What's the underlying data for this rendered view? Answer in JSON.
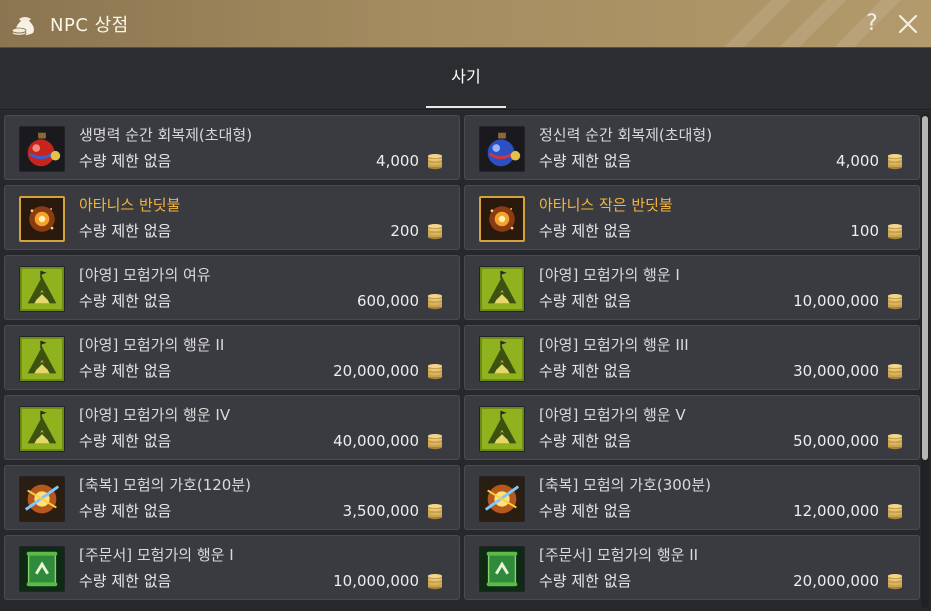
{
  "window": {
    "title": "NPC 상점",
    "help_label": "?"
  },
  "tabs": [
    {
      "label": "사기",
      "active": true
    }
  ],
  "items": [
    {
      "name": "생명력 순간 회복제(초대형)",
      "limit": "수량 제한 없음",
      "price": "4,000",
      "icon": "red-potion-icon",
      "highlight": false
    },
    {
      "name": "정신력 순간 회복제(초대형)",
      "limit": "수량 제한 없음",
      "price": "4,000",
      "icon": "blue-potion-icon",
      "highlight": false
    },
    {
      "name": "아타니스 반딧불",
      "limit": "수량 제한 없음",
      "price": "200",
      "icon": "firefly-icon",
      "highlight": true
    },
    {
      "name": "아타니스 작은 반딧불",
      "limit": "수량 제한 없음",
      "price": "100",
      "icon": "firefly-icon",
      "highlight": true
    },
    {
      "name": "[야영] 모험가의 여유",
      "limit": "수량 제한 없음",
      "price": "600,000",
      "icon": "camp-tent-icon",
      "highlight": false
    },
    {
      "name": "[야영] 모험가의 행운 I",
      "limit": "수량 제한 없음",
      "price": "10,000,000",
      "icon": "camp-tent-icon",
      "highlight": false
    },
    {
      "name": "[야영] 모험가의 행운 II",
      "limit": "수량 제한 없음",
      "price": "20,000,000",
      "icon": "camp-tent-icon",
      "highlight": false
    },
    {
      "name": "[야영] 모험가의 행운 III",
      "limit": "수량 제한 없음",
      "price": "30,000,000",
      "icon": "camp-tent-icon",
      "highlight": false
    },
    {
      "name": "[야영] 모험가의 행운 IV",
      "limit": "수량 제한 없음",
      "price": "40,000,000",
      "icon": "camp-tent-icon",
      "highlight": false
    },
    {
      "name": "[야영] 모험가의 행운 V",
      "limit": "수량 제한 없음",
      "price": "50,000,000",
      "icon": "camp-tent-icon",
      "highlight": false
    },
    {
      "name": "[축복] 모험의 가호(120분)",
      "limit": "수량 제한 없음",
      "price": "3,500,000",
      "icon": "blessing-burst-icon",
      "highlight": false
    },
    {
      "name": "[축복] 모험의 가호(300분)",
      "limit": "수량 제한 없음",
      "price": "12,000,000",
      "icon": "blessing-burst-icon",
      "highlight": false
    },
    {
      "name": "[주문서] 모험가의 행운 I",
      "limit": "수량 제한 없음",
      "price": "10,000,000",
      "icon": "scroll-icon",
      "highlight": false
    },
    {
      "name": "[주문서] 모험가의 행운 II",
      "limit": "수량 제한 없음",
      "price": "20,000,000",
      "icon": "scroll-icon",
      "highlight": false
    }
  ],
  "colors": {
    "title_bar": "#a58c60",
    "highlight_text": "#f2b53b",
    "panel": "#3a3b40",
    "background": "#27282c"
  },
  "currency_icon": "gold-coin-stack-icon"
}
